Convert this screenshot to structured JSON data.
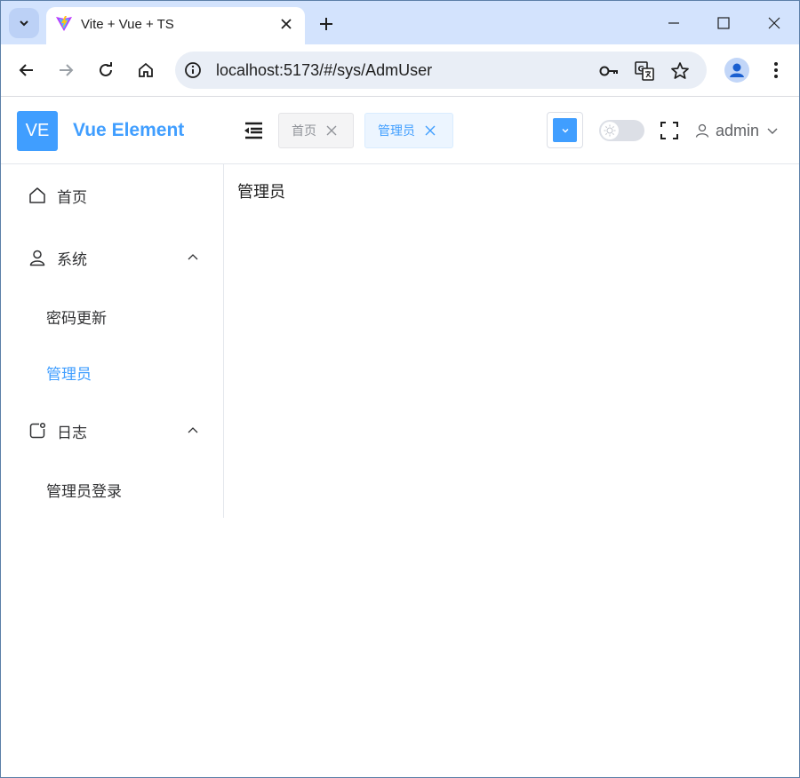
{
  "browser": {
    "tab": {
      "title": "Vite + Vue + TS"
    },
    "address": {
      "url": "localhost:5173/#/sys/AdmUser"
    }
  },
  "app": {
    "logo": {
      "badge": "VE",
      "name": "Vue Element"
    },
    "tags": [
      {
        "label": "首页",
        "active": false
      },
      {
        "label": "管理员",
        "active": true
      }
    ],
    "theme_color": "#409eff",
    "dark_mode": false,
    "user": {
      "name": "admin"
    }
  },
  "sidebar": {
    "items": [
      {
        "label": "首页",
        "icon": "home-icon"
      },
      {
        "label": "系统",
        "icon": "user-icon",
        "expanded": true,
        "children": [
          {
            "label": "密码更新"
          },
          {
            "label": "管理员",
            "active": true
          }
        ]
      },
      {
        "label": "日志",
        "icon": "log-icon",
        "expanded": true,
        "children": [
          {
            "label": "管理员登录"
          }
        ]
      }
    ]
  },
  "main": {
    "title": "管理员"
  }
}
